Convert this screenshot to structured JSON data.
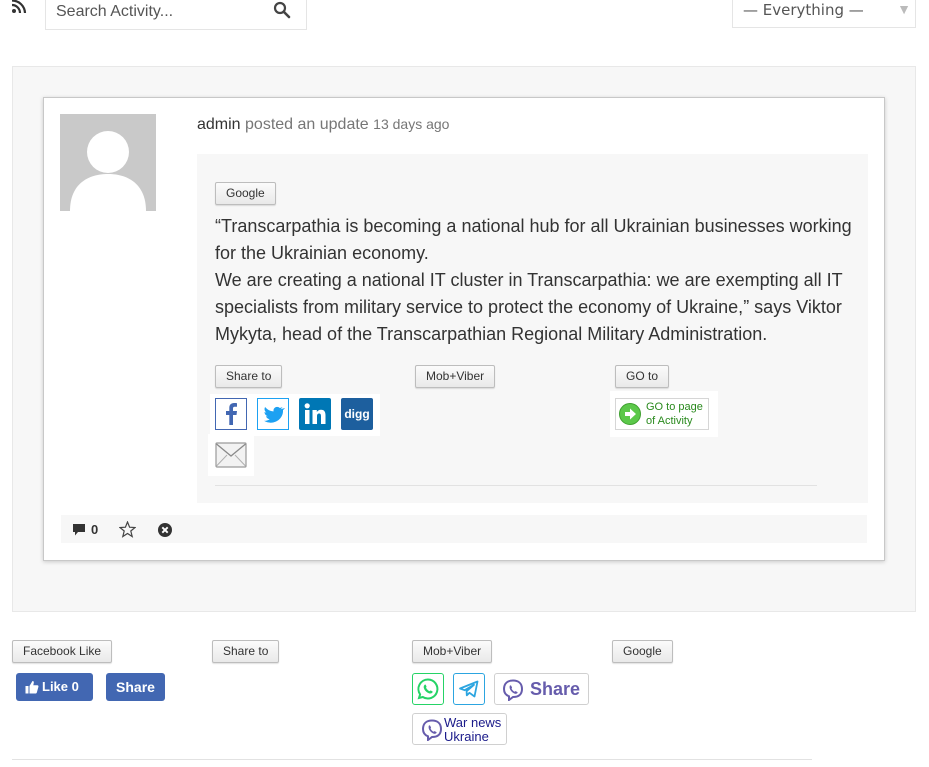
{
  "toolbar": {
    "rss_icon": "rss-icon",
    "search_placeholder": "Search Activity...",
    "search_icon": "search-icon",
    "filter_value": "— Everything —",
    "filter_arrow": "▼"
  },
  "activity": {
    "username": "admin",
    "action": "posted an update",
    "time": "13 days ago",
    "tag_button": "Google",
    "text_lines": [
      "“Transcarpathia is becoming a national hub for all Ukrainian businesses working for the Ukrainian economy.",
      "We are creating a national IT cluster in Transcarpathia: we are exempting all IT specialists from military service to protect the economy of Ukraine,” says Viktor Mykyta, head of the Transcarpathian Regional Military Administration."
    ],
    "share_to_label": "Share to",
    "mob_viber_label": "Mob+Viber",
    "go_to_label": "GO to",
    "share_icons": [
      "facebook-icon",
      "twitter-icon",
      "linkedin-icon",
      "digg-icon",
      "email-icon"
    ],
    "goto_button_text": "GO to page of Activity",
    "comment_count": "0"
  },
  "bottom": {
    "facebook_like_label": "Facebook Like",
    "share_to_label": "Share to",
    "mob_viber_label": "Mob+Viber",
    "google_label": "Google",
    "fb_like_button": "Like 0",
    "fb_share_button": "Share",
    "viber_share_text": "Share",
    "war_news_text": "War news Ukraine"
  },
  "colors": {
    "facebook": "#4267b2",
    "twitter": "#1da1f2",
    "linkedin": "#0077b5",
    "digg": "#1d5f9e",
    "viber": "#665cac",
    "whatsapp": "#25d366",
    "telegram": "#2ca5e0"
  }
}
